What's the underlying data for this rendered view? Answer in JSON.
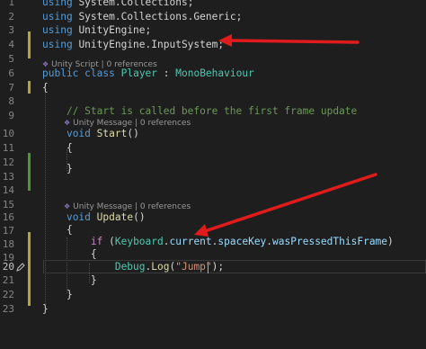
{
  "gutter": {
    "line_numbers": [
      "1",
      "2",
      "3",
      "4",
      "5",
      "6",
      "7",
      "8",
      "9",
      "10",
      "11",
      "12",
      "13",
      "14",
      "15",
      "16",
      "17",
      "18",
      "19",
      "20",
      "21",
      "22",
      "23"
    ]
  },
  "codelens": {
    "player_class": "Unity Script | 0 references",
    "start_method": "Unity Message | 0 references",
    "update_method": "Unity Message | 0 references"
  },
  "code": {
    "l1": {
      "kw": "using",
      "ns": "System.Collections",
      "end": ";"
    },
    "l2": {
      "kw": "using",
      "ns": "System.Collections.Generic",
      "end": ";"
    },
    "l3": {
      "kw": "using",
      "ns": "UnityEngine",
      "end": ";"
    },
    "l4": {
      "kw": "using",
      "ns": "UnityEngine.InputSystem",
      "end": ";"
    },
    "l6": {
      "kw1": "public",
      "kw2": "class",
      "name": "Player",
      "sep": " : ",
      "base": "MonoBehaviour"
    },
    "l7": {
      "text": "{"
    },
    "l9": {
      "comment": "// Start is called before the first frame update"
    },
    "l10": {
      "kw": "void",
      "name": "Start",
      "parens": "()"
    },
    "l11": {
      "text": "{"
    },
    "l13": {
      "text": "}"
    },
    "l16": {
      "kw": "void",
      "name": "Update",
      "parens": "()"
    },
    "l17": {
      "text": "{"
    },
    "l18": {
      "kw": "if",
      "open": " (",
      "type": "Keyboard",
      "dot1": ".",
      "p1": "current",
      "dot2": ".",
      "p2": "spaceKey",
      "dot3": ".",
      "p3": "wasPressedThisFrame",
      "close": ")"
    },
    "l19": {
      "text": "{"
    },
    "l20": {
      "type": "Debug",
      "dot": ".",
      "fn": "Log",
      "open": "(",
      "str": "\"Jump\"",
      "close": ");"
    },
    "l21": {
      "text": "}"
    },
    "l22": {
      "text": "}"
    },
    "l23": {
      "text": "}"
    }
  },
  "colors": {
    "background": "#1e1e1e",
    "keyword": "#569cd6",
    "control_keyword": "#c586c0",
    "type": "#4ec9b0",
    "method": "#dcdcaa",
    "property": "#9cdcfe",
    "string": "#ce9178",
    "comment": "#6a9955",
    "arrow": "#e01b1b",
    "change_saved": "#4c9a2a",
    "change_unsaved": "#b8a531"
  },
  "icons": {
    "codelens": "unity-script-icon",
    "edit_glyph": "pencil-icon",
    "annotations": "red-arrow-icon"
  }
}
